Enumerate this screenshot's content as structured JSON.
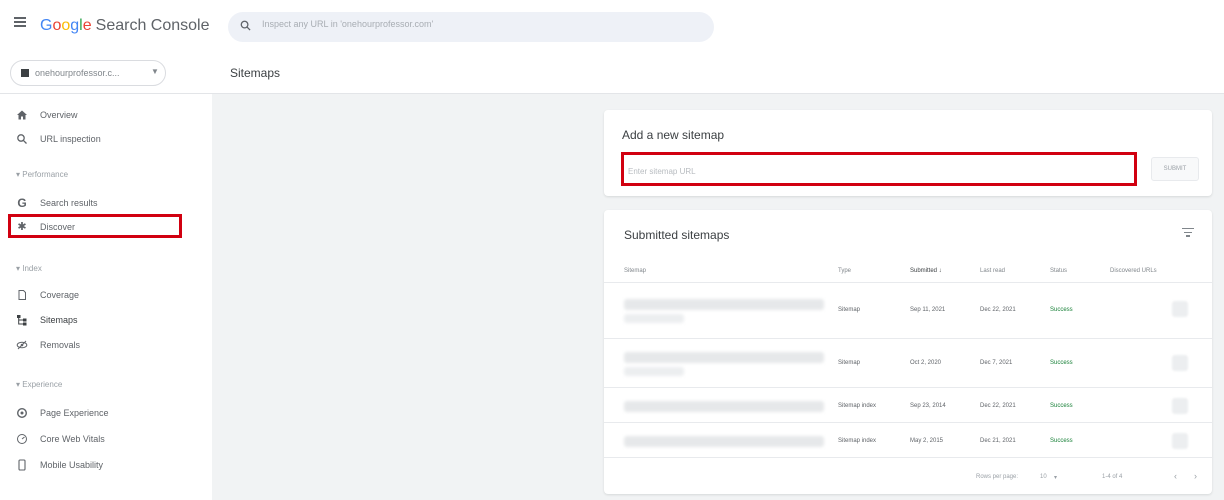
{
  "app": {
    "logo_letters": [
      "G",
      "o",
      "o",
      "g",
      "l",
      "e"
    ],
    "logo_rest": "Search Console",
    "search_placeholder": "Inspect any URL in 'onehourprofessor.com'"
  },
  "property": {
    "name": "onehourprofessor.c...",
    "caret": "▼"
  },
  "page_title": "Sitemaps",
  "sidebar": {
    "items": [
      {
        "label": "Overview",
        "icon": "home-icon"
      },
      {
        "label": "URL inspection",
        "icon": "search-icon"
      },
      {
        "label": "Search results",
        "icon": "google-g-icon"
      },
      {
        "label": "Discover",
        "icon": "asterisk-icon"
      },
      {
        "label": "Coverage",
        "icon": "document-icon"
      },
      {
        "label": "Sitemaps",
        "icon": "sitemap-icon"
      },
      {
        "label": "Removals",
        "icon": "eye-off-icon"
      },
      {
        "label": "Page Experience",
        "icon": "target-icon"
      },
      {
        "label": "Core Web Vitals",
        "icon": "gauge-icon"
      },
      {
        "label": "Mobile Usability",
        "icon": "phone-icon"
      }
    ],
    "sections": [
      "Performance",
      "Index",
      "Experience"
    ],
    "active": "Sitemaps"
  },
  "add_sitemap": {
    "title": "Add a new sitemap",
    "placeholder": "Enter sitemap URL",
    "submit_label": "SUBMIT"
  },
  "submitted": {
    "title": "Submitted sitemaps",
    "columns": [
      "Sitemap",
      "Type",
      "Submitted ↓",
      "Last read",
      "Status",
      "Discovered URLs"
    ],
    "rows": [
      {
        "type": "Sitemap",
        "submitted": "Sep 11, 2021",
        "last_read": "Dec 22, 2021",
        "status": "Success"
      },
      {
        "type": "Sitemap",
        "submitted": "Oct 2, 2020",
        "last_read": "Dec 7, 2021",
        "status": "Success"
      },
      {
        "type": "Sitemap index",
        "submitted": "Sep 23, 2014",
        "last_read": "Dec 22, 2021",
        "status": "Success"
      },
      {
        "type": "Sitemap index",
        "submitted": "May 2, 2015",
        "last_read": "Dec 21, 2021",
        "status": "Success"
      }
    ],
    "footer": {
      "rows_per_page_label": "Rows per page:",
      "rows_per_page": "10",
      "range": "1-4 of 4",
      "prev": "‹",
      "next": "›"
    }
  },
  "colors": {
    "highlight": "#d10010",
    "success": "#188038",
    "accent": "#4285f4"
  }
}
